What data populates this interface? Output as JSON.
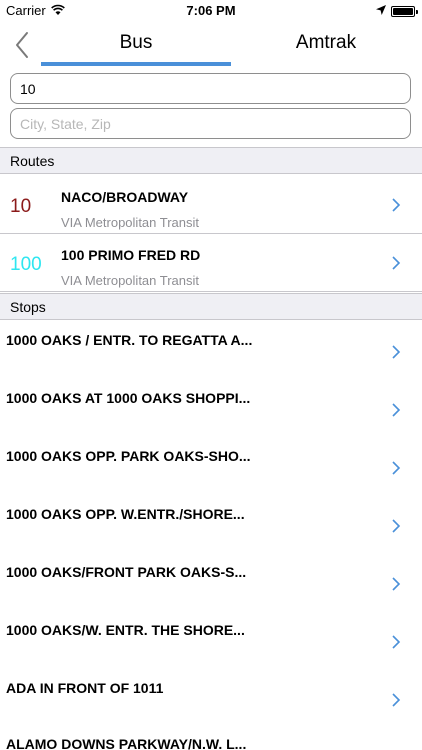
{
  "status_bar": {
    "carrier": "Carrier",
    "time": "7:06 PM",
    "icons": [
      "wifi-icon",
      "location-arrow-icon",
      "battery-icon"
    ]
  },
  "nav": {
    "back_icon": "chevron-left-icon",
    "tabs": [
      {
        "label": "Bus",
        "selected": true
      },
      {
        "label": "Amtrak",
        "selected": false
      }
    ],
    "accent_color": "#4a90d9"
  },
  "search": {
    "route_value": "10",
    "location_placeholder": "City, State, Zip"
  },
  "routes": {
    "header": "Routes",
    "items": [
      {
        "number": "10",
        "number_color": "#8b1a1a",
        "name": "NACO/BROADWAY",
        "agency": "VIA Metropolitan Transit"
      },
      {
        "number": "100",
        "number_color": "#2ee6f0",
        "name": "100 PRIMO FRED RD",
        "agency": "VIA Metropolitan Transit"
      }
    ]
  },
  "stops": {
    "header": "Stops",
    "items": [
      {
        "name": "1000 OAKS / ENTR. TO REGATTA A..."
      },
      {
        "name": "1000 OAKS AT 1000 OAKS SHOPPI..."
      },
      {
        "name": "1000 OAKS OPP. PARK OAKS-SHO..."
      },
      {
        "name": "1000 OAKS OPP. W.ENTR./SHORE..."
      },
      {
        "name": "1000 OAKS/FRONT PARK OAKS-S..."
      },
      {
        "name": "1000 OAKS/W. ENTR. THE SHORE..."
      },
      {
        "name": "ADA IN FRONT OF 1011"
      },
      {
        "name": "ALAMO DOWNS PARKWAY/N.W. L..."
      }
    ]
  },
  "chevron_icon": "chevron-right-icon",
  "chevron_color": "#4a90d9"
}
